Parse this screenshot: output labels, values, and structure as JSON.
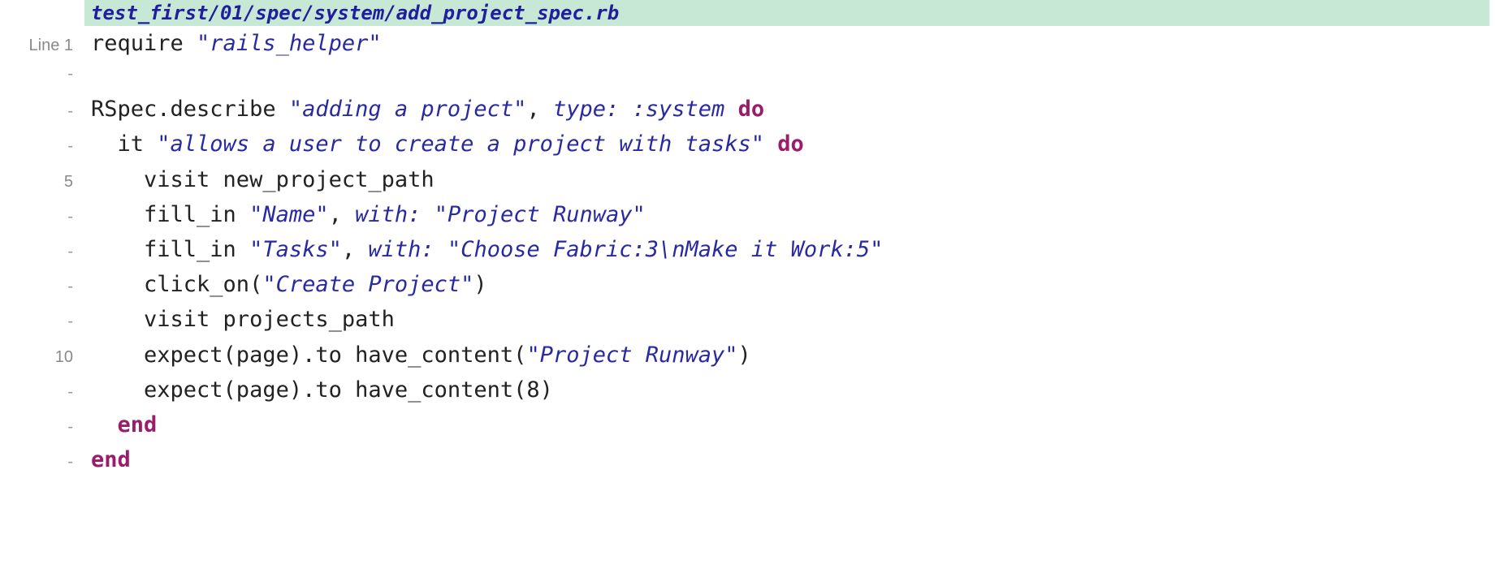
{
  "file_path": "test_first/01/spec/system/add_project_spec.rb",
  "gutter_prefix": "Line ",
  "lines": [
    {
      "n": "1",
      "tokens": [
        {
          "t": "require ",
          "c": ""
        },
        {
          "t": "\"rails_helper\"",
          "c": "str"
        }
      ]
    },
    {
      "n": "-",
      "tokens": [
        {
          "t": "",
          "c": ""
        }
      ]
    },
    {
      "n": "-",
      "tokens": [
        {
          "t": "RSpec.describe ",
          "c": ""
        },
        {
          "t": "\"adding a project\"",
          "c": "str"
        },
        {
          "t": ", ",
          "c": ""
        },
        {
          "t": "type: ",
          "c": "key"
        },
        {
          "t": ":system",
          "c": "sym"
        },
        {
          "t": " ",
          "c": ""
        },
        {
          "t": "do",
          "c": "kw"
        }
      ]
    },
    {
      "n": "-",
      "tokens": [
        {
          "t": "  it ",
          "c": ""
        },
        {
          "t": "\"allows a user to create a project with tasks\"",
          "c": "str"
        },
        {
          "t": " ",
          "c": ""
        },
        {
          "t": "do",
          "c": "kw"
        }
      ]
    },
    {
      "n": "5",
      "tokens": [
        {
          "t": "    visit new_project_path",
          "c": ""
        }
      ]
    },
    {
      "n": "-",
      "tokens": [
        {
          "t": "    fill_in ",
          "c": ""
        },
        {
          "t": "\"Name\"",
          "c": "str"
        },
        {
          "t": ", ",
          "c": ""
        },
        {
          "t": "with: ",
          "c": "key"
        },
        {
          "t": "\"Project Runway\"",
          "c": "str"
        }
      ]
    },
    {
      "n": "-",
      "tokens": [
        {
          "t": "    fill_in ",
          "c": ""
        },
        {
          "t": "\"Tasks\"",
          "c": "str"
        },
        {
          "t": ", ",
          "c": ""
        },
        {
          "t": "with: ",
          "c": "key"
        },
        {
          "t": "\"Choose Fabric:3\\nMake it Work:5\"",
          "c": "str"
        }
      ]
    },
    {
      "n": "-",
      "tokens": [
        {
          "t": "    click_on(",
          "c": ""
        },
        {
          "t": "\"Create Project\"",
          "c": "str"
        },
        {
          "t": ")",
          "c": ""
        }
      ]
    },
    {
      "n": "-",
      "tokens": [
        {
          "t": "    visit projects_path",
          "c": ""
        }
      ]
    },
    {
      "n": "10",
      "tokens": [
        {
          "t": "    expect(page).to have_content(",
          "c": ""
        },
        {
          "t": "\"Project Runway\"",
          "c": "str"
        },
        {
          "t": ")",
          "c": ""
        }
      ]
    },
    {
      "n": "-",
      "tokens": [
        {
          "t": "    expect(page).to have_content(8)",
          "c": ""
        }
      ]
    },
    {
      "n": "-",
      "tokens": [
        {
          "t": "  ",
          "c": ""
        },
        {
          "t": "end",
          "c": "kw"
        }
      ]
    },
    {
      "n": "-",
      "tokens": [
        {
          "t": "end",
          "c": "kw"
        }
      ]
    }
  ]
}
